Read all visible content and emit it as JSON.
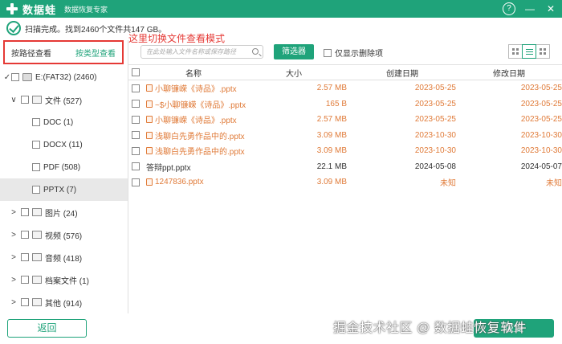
{
  "titlebar": {
    "app_name": "数据蛙",
    "subtitle": "数据恢复专家",
    "help_icon": "?",
    "minimize_icon": "—",
    "close_icon": "✕"
  },
  "status": {
    "text": "扫描完成。找到2460个文件共147 GB。"
  },
  "annotation": "这里切换文件查看模式",
  "viewmode": {
    "by_path": "按路径查看",
    "by_type": "按类型查看"
  },
  "tree": [
    {
      "label": "E:(FAT32) (2460)",
      "chevron": "✓",
      "icon": "drive"
    },
    {
      "label": "文件 (527)",
      "chevron": "∨",
      "icon": "doc"
    },
    {
      "label": "DOC (1)",
      "chevron": "",
      "icon": ""
    },
    {
      "label": "DOCX (11)",
      "chevron": "",
      "icon": ""
    },
    {
      "label": "PDF (508)",
      "chevron": "",
      "icon": ""
    },
    {
      "label": "PPTX (7)",
      "chevron": "",
      "icon": ""
    },
    {
      "label": "图片 (24)",
      "chevron": ">",
      "icon": "image"
    },
    {
      "label": "视频 (576)",
      "chevron": ">",
      "icon": "video"
    },
    {
      "label": "音频 (418)",
      "chevron": ">",
      "icon": "audio"
    },
    {
      "label": "档案文件 (1)",
      "chevron": ">",
      "icon": "archive"
    },
    {
      "label": "其他 (914)",
      "chevron": ">",
      "icon": "other"
    }
  ],
  "toolbar": {
    "search_placeholder": "在此处输入文件名称或保存路径",
    "filter_label": "筛选器",
    "only_deleted_label": "仅显示删除项"
  },
  "table": {
    "headers": {
      "name": "名称",
      "size": "大小",
      "created": "创建日期",
      "modified": "修改日期"
    },
    "rows": [
      {
        "name": "小聊镰嵘《诗品》.pptx",
        "size": "2.57 MB",
        "created": "2023-05-25",
        "modified": "2023-05-25",
        "deleted": true
      },
      {
        "name": "~$小聊镰嵘《诗品》.pptx",
        "size": "165  B",
        "created": "2023-05-25",
        "modified": "2023-05-25",
        "deleted": true
      },
      {
        "name": "小聊镰嵘《诗品》.pptx",
        "size": "2.57 MB",
        "created": "2023-05-25",
        "modified": "2023-05-25",
        "deleted": true
      },
      {
        "name": "浅聊白先勇作品中的.pptx",
        "size": "3.09 MB",
        "created": "2023-10-30",
        "modified": "2023-10-30",
        "deleted": true
      },
      {
        "name": "浅聊白先勇作品中的.pptx",
        "size": "3.09 MB",
        "created": "2023-10-30",
        "modified": "2023-10-30",
        "deleted": true
      },
      {
        "name": "答辩ppt.pptx",
        "size": "22.1 MB",
        "created": "2024-05-08",
        "modified": "2024-05-07",
        "deleted": false
      },
      {
        "name": "1247836.pptx",
        "size": "3.09 MB",
        "created": "未知",
        "modified": "未知",
        "deleted": true
      }
    ]
  },
  "footer": {
    "back_label": "返回",
    "recover_label": "恢复"
  },
  "watermark": "掘金技术社区 @ 数据蛙恢复软件",
  "colors": {
    "accent": "#1fa37a",
    "deleted": "#e07b39",
    "annotation": "#e53935"
  }
}
